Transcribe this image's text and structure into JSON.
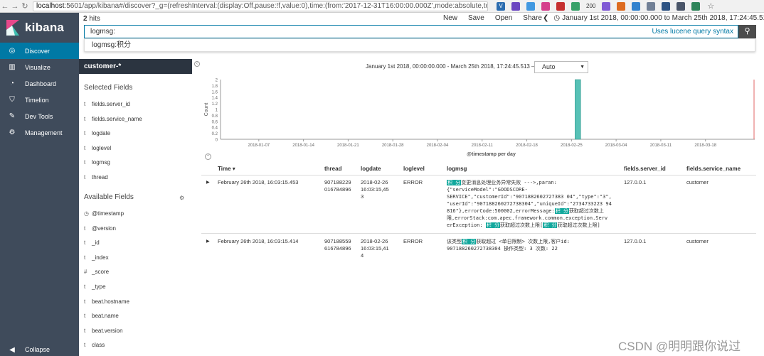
{
  "browser": {
    "url_host": "localhost",
    "url_rest": ":5601/app/kibana#/discover?_g=(refreshInterval:(display:Off,pause:!f,value:0),time:(from:'2017-12-31T16:00:00.000Z',mode:absolute,to:'2018-03-25T09:24:...",
    "extension_badge": "200"
  },
  "sidebar": {
    "brand": "kibana",
    "items": [
      {
        "label": "Discover",
        "icon": "compass-icon"
      },
      {
        "label": "Visualize",
        "icon": "bar-chart-icon"
      },
      {
        "label": "Dashboard",
        "icon": "dashboard-icon"
      },
      {
        "label": "Timelion",
        "icon": "shield-icon"
      },
      {
        "label": "Dev Tools",
        "icon": "wrench-icon"
      },
      {
        "label": "Management",
        "icon": "gear-icon"
      }
    ],
    "collapse_label": "Collapse"
  },
  "topbar": {
    "hits_count": "2",
    "hits_label": "hits",
    "actions": [
      "New",
      "Save",
      "Open",
      "Share"
    ],
    "time_range": "January 1st 2018, 00:00:00.000 to March 25th 2018, 17:24:45.513"
  },
  "query": {
    "value": "logmsg:",
    "lucene_link": "Uses lucene query syntax",
    "suggestion": "logmsg:积分"
  },
  "fields_panel": {
    "index_pattern": "customer-*",
    "selected_title": "Selected Fields",
    "selected": [
      {
        "type": "t",
        "name": "fields.server_id"
      },
      {
        "type": "t",
        "name": "fields.service_name"
      },
      {
        "type": "t",
        "name": "logdate"
      },
      {
        "type": "t",
        "name": "loglevel"
      },
      {
        "type": "t",
        "name": "logmsg"
      },
      {
        "type": "t",
        "name": "thread"
      }
    ],
    "available_title": "Available Fields",
    "available": [
      {
        "type": "◷",
        "name": "@timestamp"
      },
      {
        "type": "t",
        "name": "@version"
      },
      {
        "type": "t",
        "name": "_id"
      },
      {
        "type": "t",
        "name": "_index"
      },
      {
        "type": "#",
        "name": "_score"
      },
      {
        "type": "t",
        "name": "_type"
      },
      {
        "type": "t",
        "name": "beat.hostname"
      },
      {
        "type": "t",
        "name": "beat.name"
      },
      {
        "type": "t",
        "name": "beat.version"
      },
      {
        "type": "t",
        "name": "class"
      }
    ]
  },
  "chart_header": {
    "range": "January 1st 2018, 00:00:00.000 - March 25th 2018, 17:24:45.513 —",
    "interval": "Auto"
  },
  "chart_data": {
    "type": "bar",
    "ylabel": "Count",
    "xlabel": "@timestamp per day",
    "ylim": [
      0,
      2
    ],
    "yticks": [
      0,
      0.2,
      0.4,
      0.6,
      0.8,
      1,
      1.2,
      1.4,
      1.6,
      1.8,
      2
    ],
    "xticks": [
      "2018-01-07",
      "2018-01-14",
      "2018-01-21",
      "2018-01-28",
      "2018-02-04",
      "2018-02-11",
      "2018-02-18",
      "2018-02-25",
      "2018-03-04",
      "2018-03-11",
      "2018-03-18"
    ],
    "x": [
      "2018-02-26"
    ],
    "values": [
      2
    ],
    "bar_color": "#57c1b6",
    "now_line_color": "#e06666"
  },
  "table": {
    "columns": [
      "Time",
      "thread",
      "logdate",
      "loglevel",
      "logmsg",
      "fields.server_id",
      "fields.service_name"
    ],
    "rows": [
      {
        "time": "February 26th 2018, 16:03:15.453",
        "thread": [
          "907188229",
          "016784896"
        ],
        "logdate": [
          "2018-02-26",
          "16:03:15,45",
          "3"
        ],
        "loglevel": "ERROR",
        "server_id": "127.0.0.1",
        "service_name": "customer",
        "logmsg_lines": [
          [
            {
              "t": "积 分",
              "h": true
            },
            {
              "t": "变更消息处理业务异常失败 --->,paran:"
            }
          ],
          [
            {
              "t": "{\"serviceModel\":\"GOODSCORE-"
            }
          ],
          [
            {
              "t": "SERVICE\",\"customerId\":\"9071882602727383 04\",\"type\":\"3\","
            }
          ],
          [
            {
              "t": "\"userId\":\"907188260272738304\",\"uniqueId\":\"2734733223 94"
            }
          ],
          [
            {
              "t": "816\"},errorCode:500002,errorMessage:"
            },
            {
              "t": "积 分",
              "h": true
            },
            {
              "t": "获取超过次数上"
            }
          ],
          [
            {
              "t": "限,errorStack:com.apec.framework.common.exception.Serv"
            }
          ],
          [
            {
              "t": "erException: "
            },
            {
              "t": "积 分",
              "h": true
            },
            {
              "t": "获取超过次数上限["
            },
            {
              "t": "积 分",
              "h": true
            },
            {
              "t": "获取超过次数上限]"
            }
          ]
        ]
      },
      {
        "time": "February 26th 2018, 16:03:15.414",
        "thread": [
          "907188559",
          "616784896"
        ],
        "logdate": [
          "2018-02-26",
          "16:03:15,41",
          "4"
        ],
        "loglevel": "ERROR",
        "server_id": "127.0.0.1",
        "service_name": "customer",
        "logmsg_lines": [
          [
            {
              "t": "该类型"
            },
            {
              "t": "积 分",
              "h": true
            },
            {
              "t": "获取超过 <单日限制> 次数上限,客户id:"
            }
          ],
          [
            {
              "t": "907188260272738304 操作类型: 3 次数: 22"
            }
          ]
        ]
      }
    ]
  },
  "watermark": "CSDN @明明跟你说过"
}
